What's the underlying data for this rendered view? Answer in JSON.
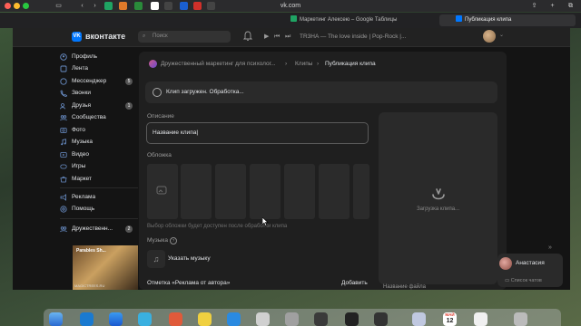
{
  "browser": {
    "url": "vk.com",
    "tabs": [
      {
        "label": "Маркетинг Алексею – Google Таблицы",
        "color": "#1fa463"
      },
      {
        "label": "Публикация клипа",
        "color": "#0077ff",
        "active": true
      }
    ]
  },
  "header": {
    "logo_text": "вконтакте",
    "logo_mark": "VK",
    "search_placeholder": "Поиск",
    "now_playing": "TR3HA — The love inside | Pop-Rock |..."
  },
  "sidebar": {
    "items": [
      {
        "label": "Профиль",
        "icon": "user-icon"
      },
      {
        "label": "Лента",
        "icon": "feed-icon"
      },
      {
        "label": "Мессенджер",
        "icon": "message-icon",
        "badge": "5"
      },
      {
        "label": "Звонки",
        "icon": "phone-icon"
      },
      {
        "label": "Друзья",
        "icon": "friends-icon",
        "badge": "1"
      },
      {
        "label": "Сообщества",
        "icon": "communities-icon"
      },
      {
        "label": "Фото",
        "icon": "photo-icon"
      },
      {
        "label": "Музыка",
        "icon": "music-icon"
      },
      {
        "label": "Видео",
        "icon": "video-icon"
      },
      {
        "label": "Игры",
        "icon": "games-icon"
      },
      {
        "label": "Маркет",
        "icon": "market-icon"
      }
    ],
    "extra": [
      {
        "label": "Реклама",
        "icon": "ads-icon"
      },
      {
        "label": "Помощь",
        "icon": "help-icon"
      }
    ],
    "community": {
      "label": "Дружественн...",
      "badge": "2"
    },
    "promo": {
      "title": "Parables Sh...",
      "sub": "MAGICTREES.RU"
    }
  },
  "breadcrumb": {
    "community": "Дружественный маркетинг для психолог...",
    "section": "Клипы",
    "current": "Публикация клипа"
  },
  "upload": {
    "status": "Клип загружен. Обработка...",
    "description_label": "Описание",
    "title_value": "Название клипа",
    "cover_label": "Обложка",
    "cover_hint": "Выбор обложки будет доступен после обработки клипа",
    "music_label": "Музыка",
    "music_action": "Указать музыку",
    "ad_label": "Отметка «Реклама от автора»",
    "ad_action": "Добавить",
    "preview_status": "Загрузка клипа...",
    "file_name_label": "Название файла"
  },
  "chat": {
    "name": "Анастасия",
    "list_label": "Список чатов"
  },
  "dock": {
    "calendar_month": "МАЙ",
    "calendar_day": "12"
  }
}
